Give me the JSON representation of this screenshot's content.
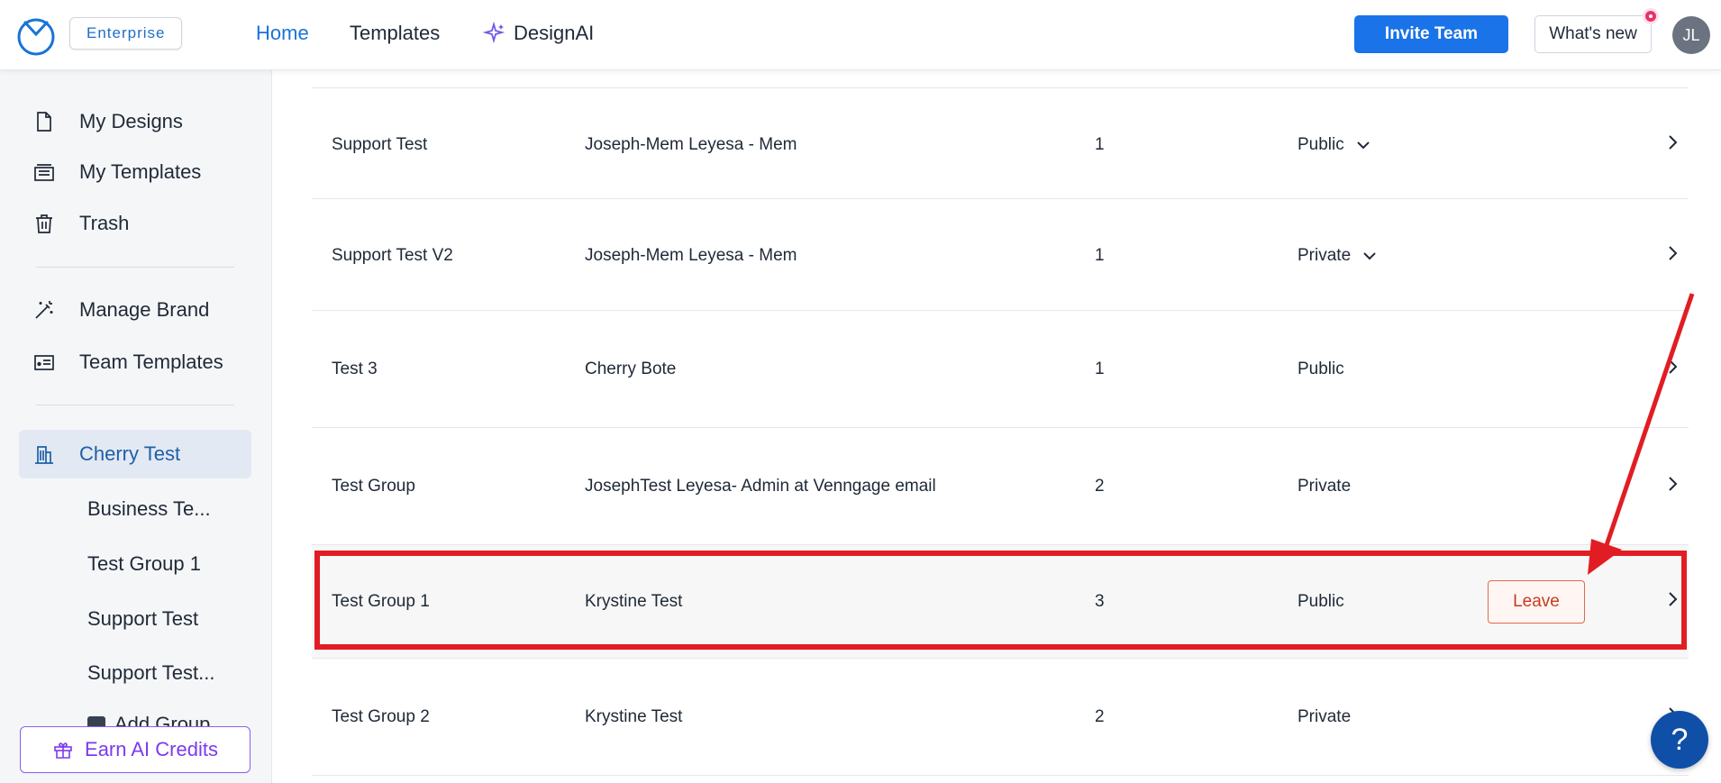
{
  "header": {
    "plan_badge": "Enterprise",
    "nav": {
      "home": "Home",
      "templates": "Templates",
      "designai": "DesignAI"
    },
    "invite_button": "Invite Team",
    "whats_new_button": "What's new",
    "avatar_initials": "JL"
  },
  "sidebar": {
    "items": {
      "my_designs": "My Designs",
      "my_templates": "My Templates",
      "trash": "Trash",
      "manage_brand": "Manage Brand",
      "team_templates": "Team Templates",
      "cherry_test": "Cherry Test"
    },
    "groups": [
      "Business Te...",
      "Test Group 1",
      "Support Test",
      "Support Test..."
    ],
    "add_group": "Add Group",
    "earn_credits": "Earn AI Credits"
  },
  "table": {
    "rows": [
      {
        "name": "Support Test",
        "owner": "Joseph-Mem Leyesa - Mem",
        "count": "1",
        "visibility": "Public"
      },
      {
        "name": "Support Test V2",
        "owner": "Joseph-Mem Leyesa - Mem",
        "count": "1",
        "visibility": "Private"
      },
      {
        "name": "Test 3",
        "owner": "Cherry Bote",
        "count": "1",
        "visibility": "Public"
      },
      {
        "name": "Test Group",
        "owner": "JosephTest Leyesa- Admin at Venngage email",
        "count": "2",
        "visibility": "Private"
      },
      {
        "name": "Test Group 1",
        "owner": "Krystine Test",
        "count": "3",
        "visibility": "Public"
      },
      {
        "name": "Test Group 2",
        "owner": "Krystine Test",
        "count": "2",
        "visibility": "Private"
      }
    ],
    "leave_button": "Leave"
  },
  "help_label": "?",
  "colors": {
    "accent": "#1a73e8",
    "annotation": "#e11d23",
    "leave": "#c53b1f"
  }
}
